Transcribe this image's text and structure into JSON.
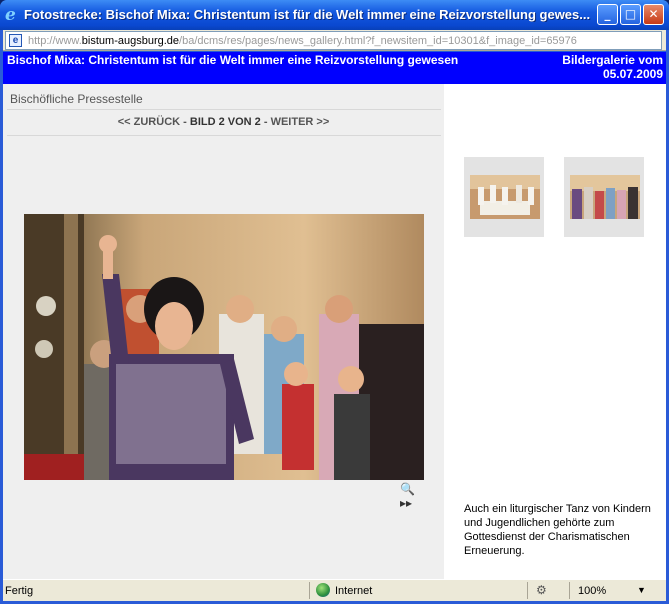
{
  "window": {
    "title": "Fotostrecke: Bischof Mixa: Christentum ist für die Welt immer eine Reizvorstellung gewes...",
    "minimize_glyph": "_",
    "maximize_glyph": "□",
    "close_glyph": "✕"
  },
  "address": {
    "prefix": "http://www.",
    "domain": "bistum-augsburg.de",
    "path": "/ba/dcms/res/pages/news_gallery.html?f_newsitem_id=10301&f_image_id=65976"
  },
  "header": {
    "title": "Bischof Mixa: Christentum ist für die Welt immer eine Reizvorstellung gewesen",
    "gallery_label": "Bildergalerie vom",
    "gallery_date": "05.07.2009"
  },
  "gallery": {
    "publisher": "Bischöfliche Pressestelle",
    "prev_label": "<< ZURÜCK",
    "sep1": "-",
    "current_label": "BILD 2 VON 2",
    "sep2": "-",
    "next_label": "WEITER >>",
    "zoom_glyph": "🔍▸▸",
    "caption": "Auch ein liturgischer Tanz von Kindern und Jugendlichen gehörte zum Gottesdienst der Charismatischen Erneuerung."
  },
  "status": {
    "text": "Fertig",
    "zone": "Internet",
    "zoom": "100%",
    "zoom_icon": "magnifier-icon",
    "caret": "▼"
  },
  "colors": {
    "header_bg": "#0000ff",
    "panel_bg": "#efefef",
    "titlebar": "#0a48d0"
  }
}
